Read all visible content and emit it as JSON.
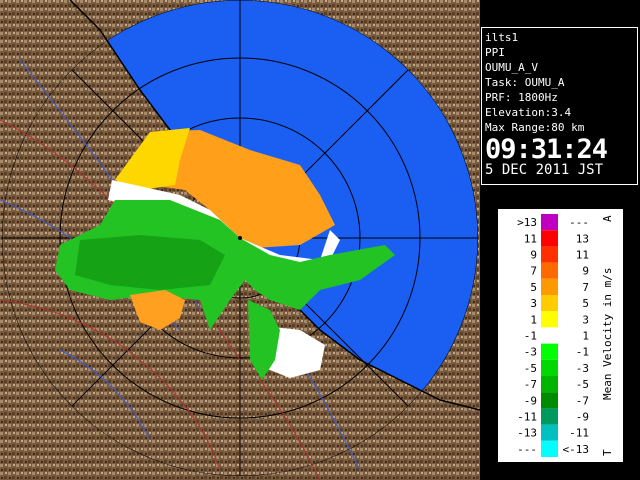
{
  "info": {
    "radar": "ilts1",
    "mode": "PPI",
    "product": "OUMU_A_V",
    "task": "Task: OUMU_A",
    "prf": "PRF: 1800Hz",
    "elevation": "Elevation:3.4",
    "max_range": "Max Range:80 km",
    "time": "09:31:24",
    "date": "5 DEC 2011 JST"
  },
  "legend": {
    "title": "Mean Velocity in m/s",
    "top_marker": "A",
    "bottom_marker": "T",
    "rows": [
      {
        "low": ">13",
        "high": "---",
        "color": "#c000c0"
      },
      {
        "low": "11",
        "high": "13",
        "color": "#ff0000"
      },
      {
        "low": "9",
        "high": "11",
        "color": "#ff3000"
      },
      {
        "low": "7",
        "high": "9",
        "color": "#ff6a00"
      },
      {
        "low": "5",
        "high": "7",
        "color": "#ff9900"
      },
      {
        "low": "3",
        "high": "5",
        "color": "#ffcc00"
      },
      {
        "low": "1",
        "high": "3",
        "color": "#ffff00"
      },
      {
        "low": "-1",
        "high": "1",
        "color": "#ffffff"
      },
      {
        "low": "-3",
        "high": "-1",
        "color": "#00ff00"
      },
      {
        "low": "-5",
        "high": "-3",
        "color": "#00d800"
      },
      {
        "low": "-7",
        "high": "-5",
        "color": "#00b400"
      },
      {
        "low": "-9",
        "high": "-7",
        "color": "#008c00"
      },
      {
        "low": "-11",
        "high": "-9",
        "color": "#009a60"
      },
      {
        "low": "-13",
        "high": "-11",
        "color": "#00c0c0"
      },
      {
        "low": "---",
        "high": "<-13",
        "color": "#00ffff"
      }
    ]
  },
  "colors": {
    "sea_range": "#1a5ff2",
    "land": "#7a5a3c",
    "range_ring": "#000000",
    "coast": "#000000"
  }
}
